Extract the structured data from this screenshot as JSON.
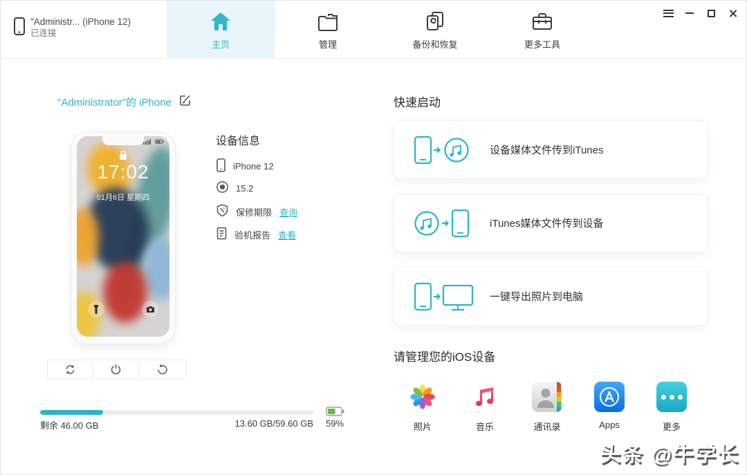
{
  "colors": {
    "accent": "#2cb6c6",
    "active_tab_bg": "#e9f4fb",
    "battery_green": "#64bc46",
    "progress_fill": "#2cb5c3"
  },
  "window": {
    "controls": [
      "menu-icon",
      "minimize-icon",
      "maximize-icon",
      "close-icon"
    ]
  },
  "header": {
    "device_summary": {
      "name": "\"Administr... (iPhone 12)",
      "status": "已连接"
    },
    "tabs": [
      {
        "id": "home",
        "label": "主页",
        "icon": "home-icon",
        "active": true
      },
      {
        "id": "manage",
        "label": "管理",
        "icon": "folder-icon",
        "active": false
      },
      {
        "id": "backup",
        "label": "备份和恢复",
        "icon": "backup-restore-icon",
        "active": false
      },
      {
        "id": "tools",
        "label": "更多工具",
        "icon": "toolbox-icon",
        "active": false
      }
    ]
  },
  "device_panel": {
    "title": "\"Administrator\"的 iPhone",
    "phone_screen": {
      "time": "17:02",
      "date": "01月6日 星期四"
    },
    "info": {
      "heading": "设备信息",
      "items": [
        {
          "icon": "phone-icon",
          "label": "",
          "value": "iPhone 12"
        },
        {
          "icon": "apple-icon",
          "label": "",
          "value": "15.2"
        },
        {
          "icon": "warranty-shield-icon",
          "label": "保修期限",
          "link": "查询"
        },
        {
          "icon": "report-doc-icon",
          "label": "验机报告",
          "link": "查看"
        }
      ]
    },
    "actions": [
      "sync-icon",
      "power-icon",
      "restore-icon"
    ],
    "storage": {
      "remaining": "剩余 46.00 GB",
      "usage": "13.60 GB/59.60 GB",
      "battery_label": "59%",
      "used_percent": 23,
      "battery_percent": 59
    }
  },
  "quick_start": {
    "heading": "快速启动",
    "cards": [
      {
        "icon": "phone-to-itunes-icon",
        "label": "设备媒体文件传到iTunes"
      },
      {
        "icon": "itunes-to-phone-icon",
        "label": "iTunes媒体文件传到设备"
      },
      {
        "icon": "phone-to-pc-icon",
        "label": "一键导出照片到电脑"
      }
    ]
  },
  "manage_section": {
    "heading": "请管理您的iOS设备",
    "apps": [
      {
        "icon": "photos-icon",
        "label": "照片"
      },
      {
        "icon": "music-icon",
        "label": "音乐"
      },
      {
        "icon": "contacts-icon",
        "label": "通讯录"
      },
      {
        "icon": "appstore-icon",
        "label": "Apps"
      },
      {
        "icon": "more-icon",
        "label": "更多"
      }
    ]
  },
  "watermark": "头条 @牛学长"
}
